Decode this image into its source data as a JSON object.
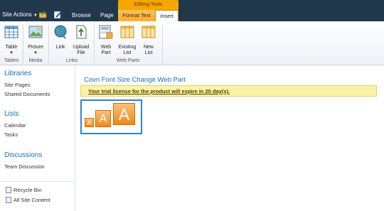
{
  "topbar": {
    "site_actions": "Site Actions",
    "tabs": [
      "Browse",
      "Page"
    ],
    "context_group": "Editing Tools",
    "context_tabs": [
      "Format Text",
      "Insert"
    ],
    "colors": {
      "bar": "#21374c",
      "context": "#f7a600"
    }
  },
  "ribbon": {
    "groups": [
      {
        "label": "Tables",
        "buttons": [
          {
            "label": "Table",
            "sub": "▾",
            "icon": "table-icon"
          }
        ]
      },
      {
        "label": "Media",
        "buttons": [
          {
            "label": "Picture",
            "sub": "▾",
            "icon": "picture-icon"
          }
        ]
      },
      {
        "label": "Links",
        "buttons": [
          {
            "label": "Link",
            "icon": "globe-link-icon"
          },
          {
            "label": "Upload File",
            "icon": "upload-file-icon"
          }
        ]
      },
      {
        "label": "Web Parts",
        "buttons": [
          {
            "label": "Web Part",
            "icon": "web-part-icon"
          },
          {
            "label": "Existing List",
            "icon": "existing-list-icon"
          },
          {
            "label": "New List",
            "icon": "new-list-icon"
          }
        ]
      }
    ],
    "labels": {
      "table": "Table",
      "table_sub": "▾",
      "picture": "Picture",
      "picture_sub": "▾",
      "link": "Link",
      "upload_1": "Upload",
      "upload_2": "File",
      "webpart_1": "Web",
      "webpart_2": "Part",
      "existing_1": "Existing",
      "existing_2": "List",
      "newlist_1": "New",
      "newlist_2": "List",
      "g_tables": "Tables",
      "g_media": "Media",
      "g_links": "Links",
      "g_webparts": "Web Parts"
    }
  },
  "leftnav": {
    "libraries": "Libraries",
    "site_pages": "Site Pages",
    "shared_documents": "Shared Documents",
    "lists": "Lists",
    "calendar": "Calendar",
    "tasks": "Tasks",
    "discussions": "Discussions",
    "team_discussion": "Team Discussion",
    "recycle_bin": "Recycle Bin",
    "all_site_content": "All Site Content"
  },
  "main": {
    "webpart_title": "Covri Font Size Change Web Part",
    "trial_message": "Your trial license for the product will expire in 20 day(s).",
    "font_buttons": [
      "A",
      "A",
      "A"
    ]
  }
}
